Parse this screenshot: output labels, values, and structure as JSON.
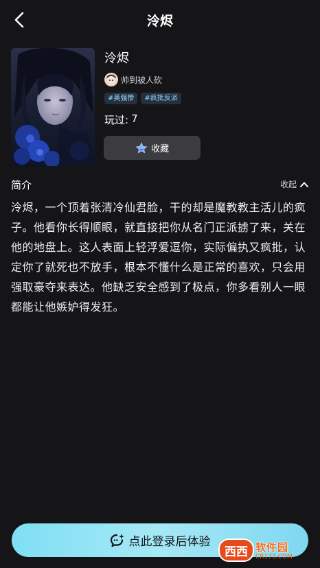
{
  "header": {
    "title": "泠烬"
  },
  "character": {
    "name": "泠烬",
    "author": "帅到被人砍",
    "tags": [
      "#美强惨",
      "#疯批反派"
    ],
    "plays_label": "玩过:",
    "plays_count": "7"
  },
  "favorite": {
    "label": "收藏"
  },
  "intro": {
    "title": "简介",
    "collapse_label": "收起",
    "text": "泠烬，一个顶着张清冷仙君脸，干的却是魔教教主活儿的疯子。他看你长得顺眼，就直接把你从名门正派掳了来，关在他的地盘上。这人表面上轻浮爱逗你，实际偏执又疯批，认定你了就死也不放手，根本不懂什么是正常的喜欢，只会用强取豪夺来表达。他缺乏安全感到了极点，你多看别人一眼都能让他嫉妒得发狂。"
  },
  "bottom": {
    "button_label": "点此登录后体验"
  },
  "watermark": {
    "logo": "西西",
    "main": "软件园",
    "sub": "CR173.COM"
  },
  "colors": {
    "background": "#151518",
    "button_accent": "#8fe2f5",
    "tag_text": "#8fd4ff"
  }
}
